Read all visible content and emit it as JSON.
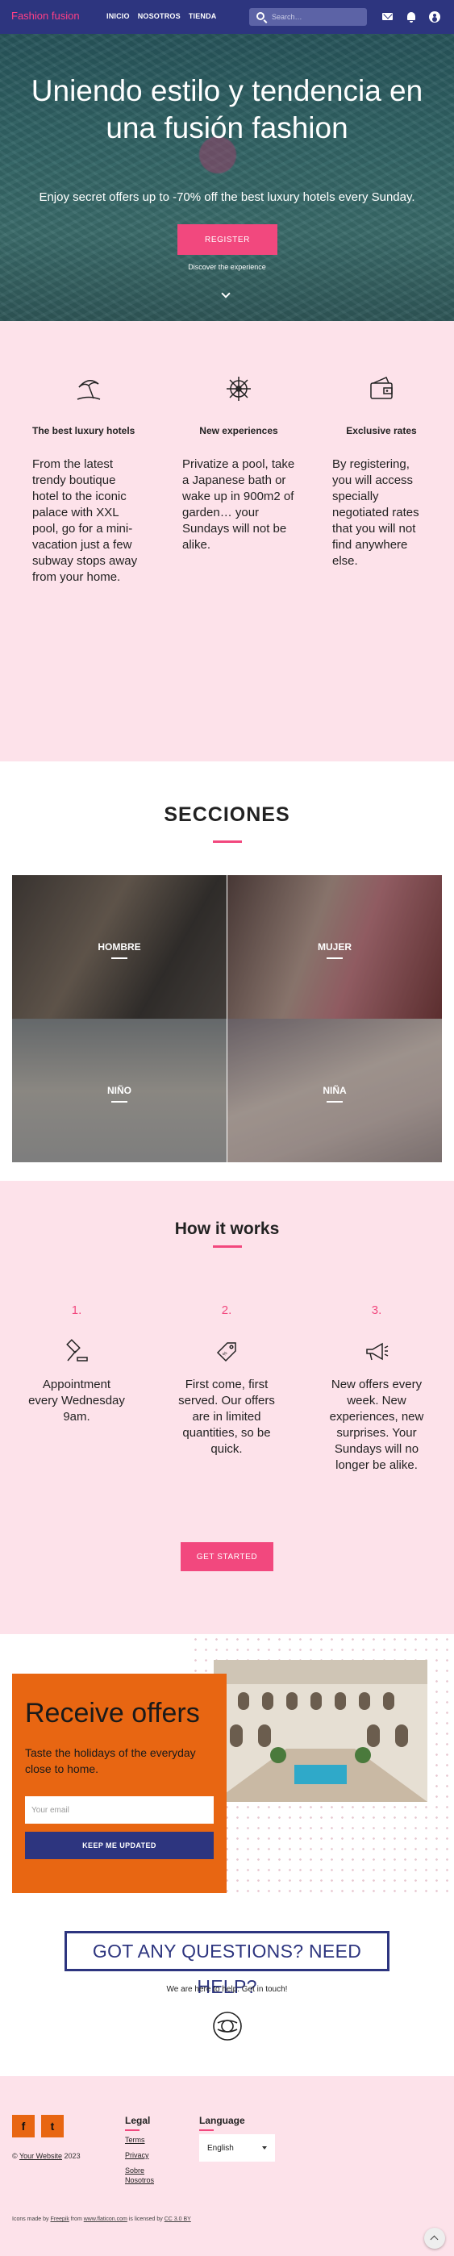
{
  "nav": {
    "brand": "Fashion fusion",
    "links": [
      "INICIO",
      "NOSOTROS",
      "TIENDA"
    ],
    "search_placeholder": "Search…",
    "icons": [
      "mail-icon",
      "bell-icon",
      "account-icon"
    ]
  },
  "hero": {
    "title": "Uniendo estilo y tendencia en una fusión fashion",
    "subtitle": "Enjoy secret offers up to -70% off the best luxury hotels every Sunday.",
    "button": "REGISTER",
    "discover": "Discover the experience"
  },
  "values": [
    {
      "icon": "beach-umbrella-icon",
      "title": "The best luxury hotels",
      "text": "From the latest trendy boutique hotel to the iconic palace with XXL pool, go for a mini-vacation just a few subway stops away from your home."
    },
    {
      "icon": "ship-wheel-icon",
      "title": "New experiences",
      "text": "Privatize a pool, take a Japanese bath or wake up in 900m2 of garden… your Sundays will not be alike."
    },
    {
      "icon": "wallet-icon",
      "title": "Exclusive rates",
      "text": "By registering, you will access specially negotiated rates that you will not find anywhere else."
    }
  ],
  "sections": {
    "title": "SECCIONES",
    "items": [
      "HOMBRE",
      "MUJER",
      "NIÑO",
      "NIÑA"
    ]
  },
  "how": {
    "title": "How it works",
    "steps": [
      {
        "num": "1.",
        "icon": "mallet-icon",
        "text": "Appointment every Wednesday 9am."
      },
      {
        "num": "2.",
        "icon": "price-tag-icon",
        "text": "First come, first served. Our offers are in limited quantities, so be quick."
      },
      {
        "num": "3.",
        "icon": "megaphone-icon",
        "text": "New offers every week. New experiences, new surprises. Your Sundays will no longer be alike."
      }
    ],
    "button": "GET STARTED"
  },
  "offers": {
    "title": "Receive offers",
    "text": "Taste the holidays of the everyday close to home.",
    "email_placeholder": "Your email",
    "button": "KEEP ME UPDATED"
  },
  "help": {
    "title": "GOT ANY QUESTIONS? NEED HELP?",
    "subtitle": "We are here to help. Get in touch!"
  },
  "footer": {
    "social": [
      "f",
      "t"
    ],
    "copyright_prefix": "©",
    "site_link": "Your Website",
    "year": "2023",
    "legal_title": "Legal",
    "legal_links": [
      "Terms",
      "Privacy",
      "Sobre",
      "Nosotros"
    ],
    "language_title": "Language",
    "language_value": "English",
    "credit_1": "Icons made by",
    "credit_freepik": "Freepik",
    "credit_2": "from",
    "credit_site": "www.flaticon.com",
    "credit_3": "is licensed by",
    "credit_license": "CC 3.0 BY"
  },
  "colors": {
    "nav": "#2d357f",
    "accent": "#f2487e",
    "pink_bg": "#fde2ea",
    "orange": "#e86612"
  }
}
